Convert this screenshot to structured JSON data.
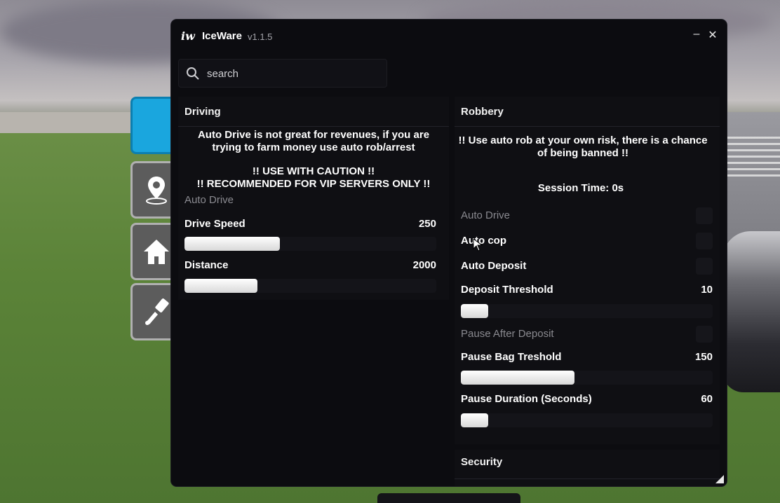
{
  "window": {
    "logo": "iw",
    "title": "IceWare",
    "version": "v1.1.5",
    "minimize": "–",
    "close": "✕"
  },
  "search": {
    "placeholder": "search"
  },
  "dock": [
    {
      "icon": "blank-icon",
      "active": true
    },
    {
      "icon": "location-pin-icon",
      "active": false
    },
    {
      "icon": "home-icon",
      "active": false
    },
    {
      "icon": "paint-brush-icon",
      "active": false
    }
  ],
  "driving": {
    "title": "Driving",
    "note1_line1": "Auto Drive is not great for revenues, if you are",
    "note1_line2": "trying to farm money use auto rob/arrest",
    "note2_line1": "!! USE WITH CAUTION !!",
    "note2_line2": "!! RECOMMENDED FOR VIP SERVERS ONLY !!",
    "auto_drive": "Auto Drive",
    "drive_speed": {
      "label": "Drive Speed",
      "value": "250",
      "fill": 0.38
    },
    "distance": {
      "label": "Distance",
      "value": "2000",
      "fill": 0.29
    }
  },
  "robbery": {
    "title": "Robbery",
    "warning_line1": "!! Use auto rob at your own risk, there is a chance",
    "warning_line2": "of being banned !!",
    "session_time": "Session Time: 0s",
    "auto_drive": "Auto Drive",
    "auto_cop": "Auto cop",
    "auto_deposit": "Auto Deposit",
    "deposit_threshold": {
      "label": "Deposit Threshold",
      "value": "10",
      "fill": 0.11
    },
    "pause_after_deposit": "Pause After Deposit",
    "pause_bag_threshold": {
      "label": "Pause Bag Treshold",
      "value": "150",
      "fill": 0.45
    },
    "pause_duration": {
      "label": "Pause Duration (Seconds)",
      "value": "60",
      "fill": 0.11
    }
  },
  "security": {
    "title": "Security"
  },
  "colors": {
    "accent": "#1aa6de",
    "window_bg": "#0c0c10",
    "panel_bg": "#0f0f13"
  }
}
